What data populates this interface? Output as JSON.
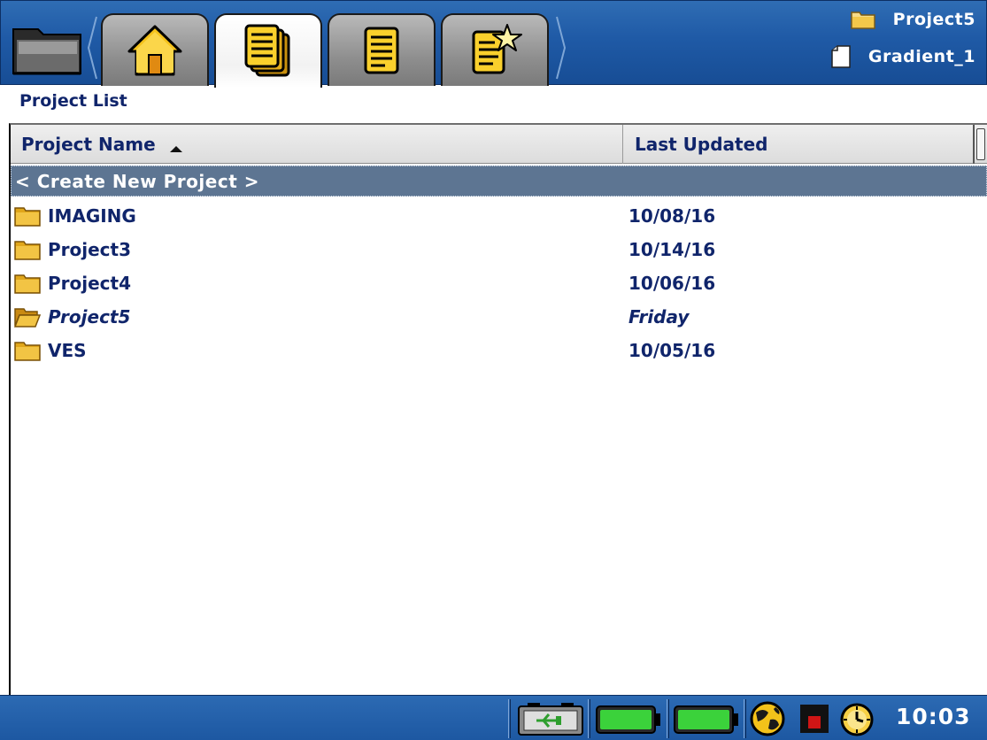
{
  "app": {
    "tabs": [
      {
        "name": "home",
        "icon": "home-icon",
        "active": false
      },
      {
        "name": "projects",
        "icon": "project-stack-icon",
        "active": true
      },
      {
        "name": "files",
        "icon": "document-icon",
        "active": false
      },
      {
        "name": "favorites",
        "icon": "document-star-icon",
        "active": false
      }
    ],
    "context": {
      "project": "Project5",
      "file": "Gradient_1"
    }
  },
  "page": {
    "title": "Project List"
  },
  "table": {
    "columns": {
      "name": "Project Name",
      "updated": "Last Updated"
    },
    "sort": {
      "column": "name",
      "direction": "ascending"
    },
    "create_row": "< Create New Project >",
    "rows": [
      {
        "name": "IMAGING",
        "updated": "10/08/16",
        "current": false
      },
      {
        "name": "Project3",
        "updated": "10/14/16",
        "current": false
      },
      {
        "name": "Project4",
        "updated": "10/06/16",
        "current": false
      },
      {
        "name": "Project5",
        "updated": "Friday",
        "current": true
      },
      {
        "name": "VES",
        "updated": "10/05/16",
        "current": false
      }
    ]
  },
  "status": {
    "icons": [
      "power-plug-icon",
      "battery-1-icon",
      "battery-2-icon",
      "network-globe-icon",
      "record-indicator-icon",
      "clock-icon"
    ],
    "time": "10:03"
  },
  "colors": {
    "header_blue": "#1f5aa6",
    "text_navy": "#10256b",
    "selection": "#5d7592",
    "battery_green": "#3bd23b",
    "record_red": "#d01515"
  }
}
